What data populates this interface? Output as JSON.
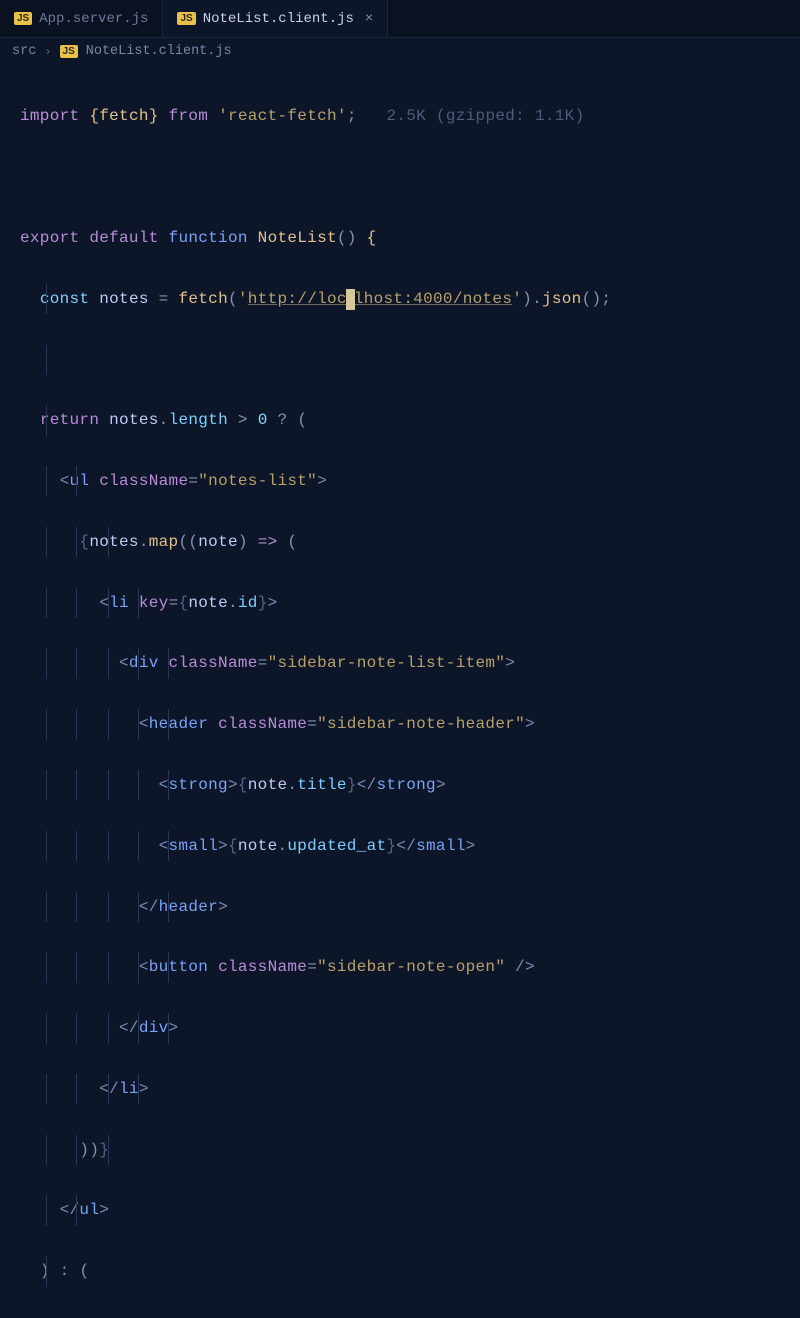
{
  "tabs": [
    {
      "label": "App.server.js",
      "active": false
    },
    {
      "label": "NoteList.client.js",
      "active": true
    }
  ],
  "breadcrumb": {
    "seg1": "src",
    "seg2": "NoteList.client.js"
  },
  "code": {
    "l1_import": "import",
    "l1_lbrace": "{",
    "l1_fetch": "fetch",
    "l1_rbrace": "}",
    "l1_from": "from",
    "l1_module": "'react-fetch'",
    "l1_semi": ";",
    "l1_hint": "2.5K (gzipped: 1.1K)",
    "l3_export": "export",
    "l3_default": "default",
    "l3_function": "function",
    "l3_name": "NoteList",
    "l3_parens": "()",
    "l3_brace": "{",
    "l4_const": "const",
    "l4_notes": "notes",
    "l4_eq": "=",
    "l4_fetch": "fetch",
    "l4_lp": "(",
    "l4_q1": "'",
    "l4_url_a": "http://loc",
    "l4_url_cursor": "a",
    "l4_url_b": "lhost:4000/notes",
    "l4_q2": "'",
    "l4_rp": ")",
    "l4_dot1": ".",
    "l4_json": "json",
    "l4_parens2": "()",
    "l4_semi": ";",
    "l6_return": "return",
    "l6_notes": "notes",
    "l6_dot": ".",
    "l6_length": "length",
    "l6_gt": ">",
    "l6_zero": "0",
    "l6_q": "?",
    "l6_lp": "(",
    "l7_ul": "ul",
    "l7_cn": "className",
    "l7_eq": "=",
    "l7_val": "\"notes-list\"",
    "l8_lb": "{",
    "l8_notes": "notes",
    "l8_dot": ".",
    "l8_map": "map",
    "l8_lp": "(",
    "l8_lp2": "(",
    "l8_note": "note",
    "l8_rp2": ")",
    "l8_arrow": "=>",
    "l8_lp3": "(",
    "l9_li": "li",
    "l9_key": "key",
    "l9_eq": "=",
    "l9_lb": "{",
    "l9_note": "note",
    "l9_dot": ".",
    "l9_id": "id",
    "l9_rb": "}",
    "l10_div": "div",
    "l10_cn": "className",
    "l10_eq": "=",
    "l10_val": "\"sidebar-note-list-item\"",
    "l11_header": "header",
    "l11_cn": "className",
    "l11_eq": "=",
    "l11_val": "\"sidebar-note-header\"",
    "l12_strong": "strong",
    "l12_lb": "{",
    "l12_note": "note",
    "l12_dot": ".",
    "l12_title": "title",
    "l12_rb": "}",
    "l13_small": "small",
    "l13_lb": "{",
    "l13_note": "note",
    "l13_dot": ".",
    "l13_upd": "updated_at",
    "l13_rb": "}",
    "l14_header": "header",
    "l15_button": "button",
    "l15_cn": "className",
    "l15_eq": "=",
    "l15_val": "\"sidebar-note-open\"",
    "l16_div": "div",
    "l17_li": "li",
    "l18_rp": ")",
    "l18_rp2": ")",
    "l18_rb": "}",
    "l19_ul": "ul",
    "l20_rp": ")",
    "l20_colon": ":",
    "l20_lp": "("
  }
}
